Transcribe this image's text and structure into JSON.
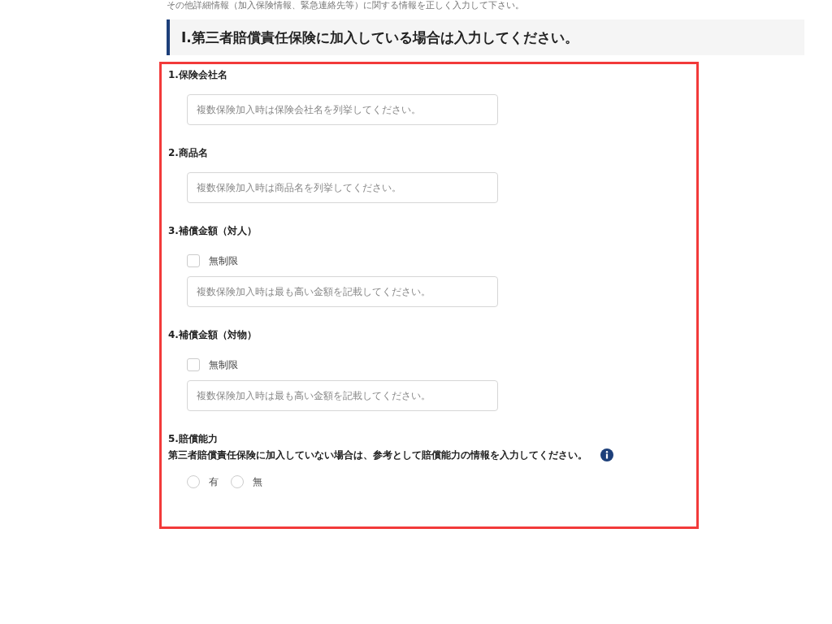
{
  "intro_text": "その他詳細情報（加入保険情報、緊急連絡先等）に関する情報を正しく入力して下さい。",
  "section_heading": "Ⅰ.第三者賠償責任保険に加入している場合は入力してください。",
  "highlighted": true,
  "fields": [
    {
      "kind": "text",
      "label": "1.保険会社名",
      "placeholder": "複数保険加入時は保険会社名を列挙してください。"
    },
    {
      "kind": "text",
      "label": "2.商品名",
      "placeholder": "複数保険加入時は商品名を列挙してください。"
    },
    {
      "kind": "checkbox_text",
      "label": "3.補償金額（対人）",
      "checkbox": {
        "label": "無制限",
        "checked": false
      },
      "placeholder": "複数保険加入時は最も高い金額を記載してください。"
    },
    {
      "kind": "checkbox_text",
      "label": "4.補償金額（対物）",
      "checkbox": {
        "label": "無制限",
        "checked": false
      },
      "placeholder": "複数保険加入時は最も高い金額を記載してください。"
    },
    {
      "kind": "radio",
      "label": "5.賠償能力",
      "note": "第三者賠償責任保険に加入していない場合は、参考として賠償能力の情報を入力してください。",
      "info_icon": true,
      "options": [
        {
          "label": "有",
          "selected": false
        },
        {
          "label": "無",
          "selected": false
        }
      ]
    }
  ]
}
